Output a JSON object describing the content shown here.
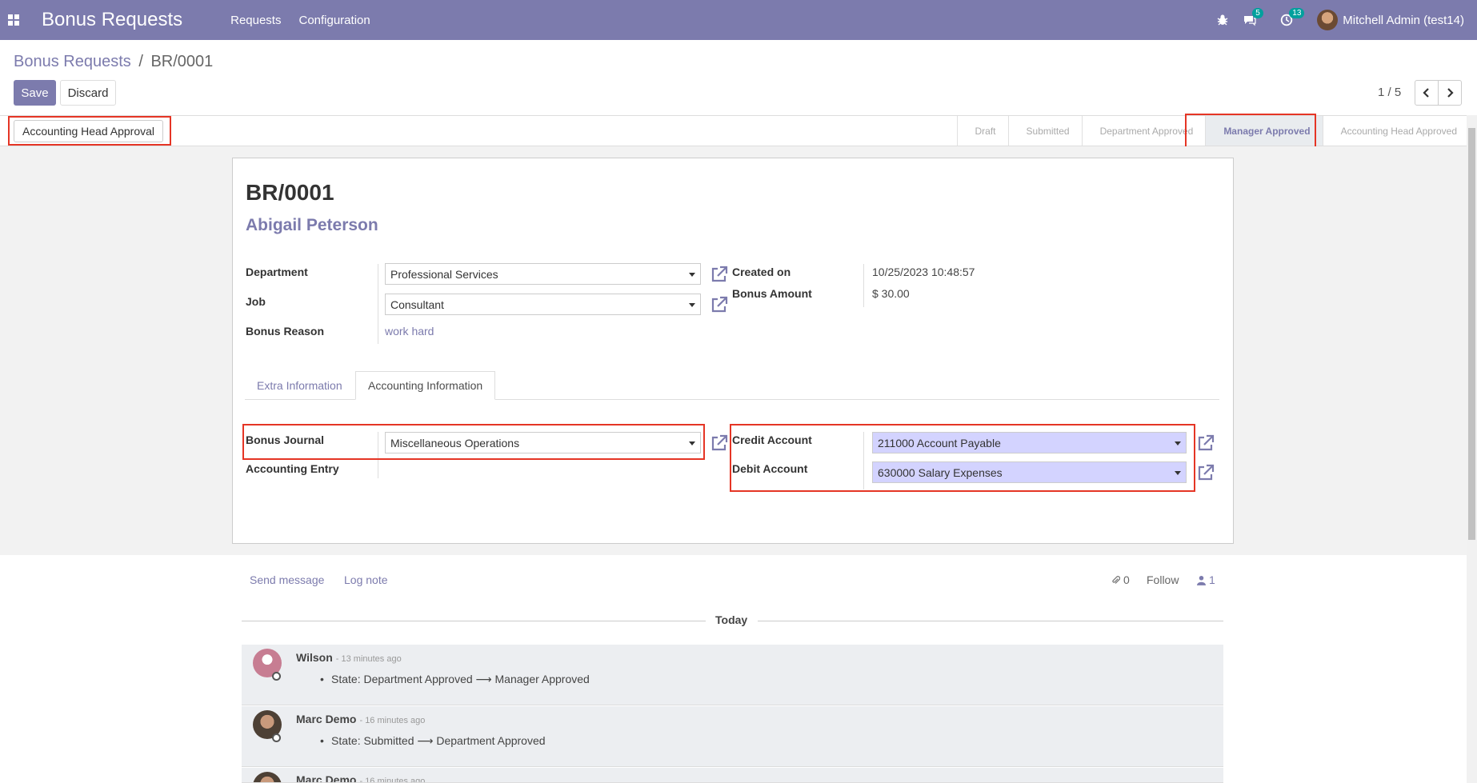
{
  "navbar": {
    "app_title": "Bonus Requests",
    "menus": [
      "Requests",
      "Configuration"
    ],
    "messages_count": "5",
    "activities_count": "13",
    "user": "Mitchell Admin (test14)"
  },
  "breadcrumb": {
    "parent": "Bonus Requests",
    "separator": "/",
    "current": "BR/0001"
  },
  "buttons": {
    "save": "Save",
    "discard": "Discard"
  },
  "pager": {
    "value": "1 / 5"
  },
  "statusbar": {
    "action": "Accounting Head Approval",
    "stages": [
      {
        "label": "Draft",
        "active": false
      },
      {
        "label": "Submitted",
        "active": false
      },
      {
        "label": "Department Approved",
        "active": false
      },
      {
        "label": "Manager Approved",
        "active": true
      },
      {
        "label": "Accounting Head Approved",
        "active": false
      }
    ]
  },
  "form": {
    "title": "BR/0001",
    "employee": "Abigail Peterson",
    "labels": {
      "department": "Department",
      "job": "Job",
      "bonus_reason": "Bonus Reason",
      "created_on": "Created on",
      "bonus_amount": "Bonus Amount"
    },
    "values": {
      "department": "Professional Services",
      "job": "Consultant",
      "bonus_reason": "work hard",
      "created_on": "10/25/2023 10:48:57",
      "bonus_amount": "$ 30.00"
    },
    "tabs": [
      "Extra Information",
      "Accounting Information"
    ],
    "accounting": {
      "labels": {
        "bonus_journal": "Bonus Journal",
        "accounting_entry": "Accounting Entry",
        "credit_account": "Credit Account",
        "debit_account": "Debit Account"
      },
      "values": {
        "bonus_journal": "Miscellaneous Operations",
        "credit_account": "211000 Account Payable",
        "debit_account": "630000 Salary Expenses"
      }
    }
  },
  "chatter": {
    "send_message": "Send message",
    "log_note": "Log note",
    "attachments": "0",
    "follow": "Follow",
    "followers": "1",
    "today": "Today",
    "messages": [
      {
        "author": "Wilson",
        "time": "- 13 minutes ago",
        "body": "State: Department Approved ⟶ Manager Approved"
      },
      {
        "author": "Marc Demo",
        "time": "- 16 minutes ago",
        "body": "State: Submitted ⟶ Department Approved"
      },
      {
        "author": "Marc Demo",
        "time": "- 16 minutes ago",
        "body": ""
      }
    ]
  },
  "colors": {
    "brand": "#7c7bad",
    "highlight": "#e53525",
    "teal": "#00a09d"
  }
}
